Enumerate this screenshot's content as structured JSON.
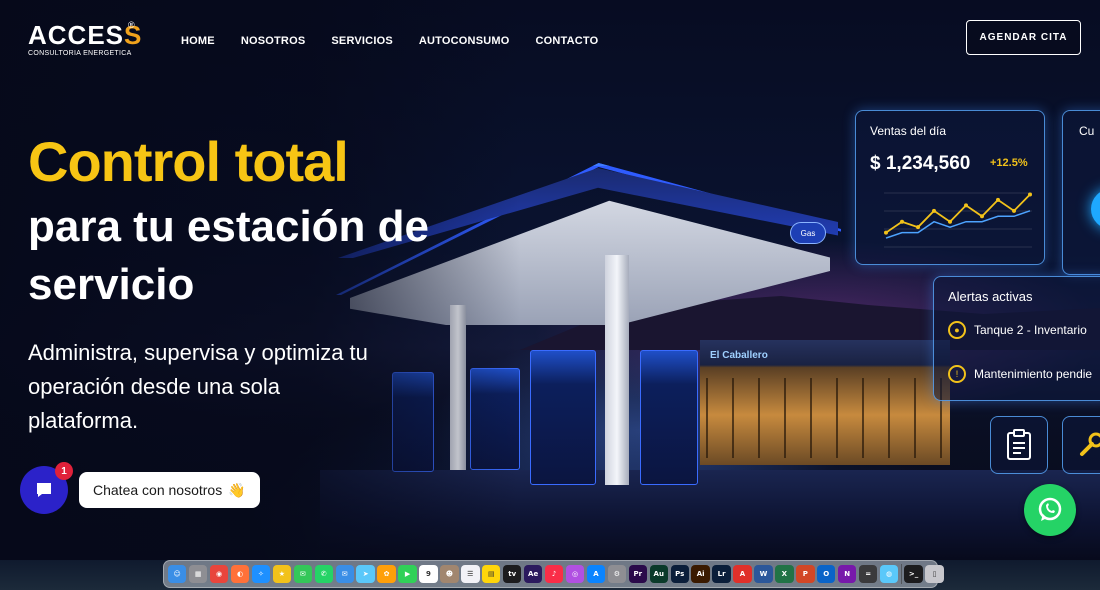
{
  "brand": {
    "logo_main": "ACCES",
    "logo_accent": "S",
    "registered": "®",
    "tagline": "CONSULTORIA ENERGETICA"
  },
  "nav": {
    "items": [
      {
        "label": "HOME"
      },
      {
        "label": "NOSOTROS"
      },
      {
        "label": "SERVICIOS"
      },
      {
        "label": "AUTOCONSUMO"
      },
      {
        "label": "CONTACTO"
      }
    ],
    "cta_label": "AGENDAR CITA"
  },
  "hero": {
    "headline_accent": "Control total",
    "headline_rest": "para tu estación de servicio",
    "description": "Administra, supervisa y optimiza tu operación desde una sola plataforma."
  },
  "dashboard": {
    "sales": {
      "title": "Ventas del día",
      "value": "$ 1,234,560",
      "change": "+12.5%",
      "chart_values_yellow": [
        3,
        5,
        4,
        7,
        5,
        8,
        6,
        9,
        7,
        10
      ],
      "chart_values_blue": [
        2,
        3,
        3,
        5,
        4,
        5,
        5,
        6,
        6,
        7
      ]
    },
    "second_card_title": "Cu",
    "alerts": {
      "title": "Alertas activas",
      "items": [
        {
          "text": "Tanque 2 - Inventario"
        },
        {
          "text": "Mantenimiento pendie"
        }
      ]
    }
  },
  "station": {
    "store_sign": "El Caballero",
    "brand_badge": "Gas"
  },
  "chat": {
    "badge_count": "1",
    "bubble_text": "Chatea con nosotros",
    "bubble_emoji": "👋"
  },
  "dock": {
    "icons": [
      {
        "name": "finder",
        "color": "#3a8ee6",
        "glyph": "☺"
      },
      {
        "name": "launchpad",
        "color": "#8e8e93",
        "glyph": "▦"
      },
      {
        "name": "chrome",
        "color": "#e8453c",
        "glyph": "◉"
      },
      {
        "name": "firefox",
        "color": "#ff7139",
        "glyph": "◐"
      },
      {
        "name": "safari",
        "color": "#1e90ff",
        "glyph": "✧"
      },
      {
        "name": "reeder",
        "color": "#f2c21a",
        "glyph": "★"
      },
      {
        "name": "messages",
        "color": "#34c759",
        "glyph": "✉"
      },
      {
        "name": "whatsapp",
        "color": "#25d366",
        "glyph": "✆"
      },
      {
        "name": "mail",
        "color": "#3a8ee6",
        "glyph": "✉"
      },
      {
        "name": "maps",
        "color": "#5ac8fa",
        "glyph": "➤"
      },
      {
        "name": "photos",
        "color": "#ff9f0a",
        "glyph": "✿"
      },
      {
        "name": "facetime",
        "color": "#30d158",
        "glyph": "▶"
      },
      {
        "name": "calendar",
        "color": "#ffffff",
        "glyph": "9"
      },
      {
        "name": "contacts",
        "color": "#a1866f",
        "glyph": "☻"
      },
      {
        "name": "reminders",
        "color": "#f2f2f7",
        "glyph": "☰"
      },
      {
        "name": "notes",
        "color": "#ffd60a",
        "glyph": "▤"
      },
      {
        "name": "tv",
        "color": "#1c1c1e",
        "glyph": "tv"
      },
      {
        "name": "after-effects",
        "color": "#2b1a5e",
        "glyph": "Ae"
      },
      {
        "name": "music",
        "color": "#fa2d48",
        "glyph": "♪"
      },
      {
        "name": "podcasts",
        "color": "#b150e2",
        "glyph": "◎"
      },
      {
        "name": "app-store",
        "color": "#0a84ff",
        "glyph": "A"
      },
      {
        "name": "system-settings",
        "color": "#8e8e93",
        "glyph": "⚙"
      },
      {
        "name": "premiere",
        "color": "#2a0a4a",
        "glyph": "Pr"
      },
      {
        "name": "audition",
        "color": "#0a3a2a",
        "glyph": "Au"
      },
      {
        "name": "photoshop",
        "color": "#0a1e3a",
        "glyph": "Ps"
      },
      {
        "name": "illustrator",
        "color": "#3a1a00",
        "glyph": "Ai"
      },
      {
        "name": "lightroom",
        "color": "#0a1e3a",
        "glyph": "Lr"
      },
      {
        "name": "acrobat",
        "color": "#e0302a",
        "glyph": "A"
      },
      {
        "name": "word",
        "color": "#2b579a",
        "glyph": "W"
      },
      {
        "name": "excel",
        "color": "#217346",
        "glyph": "X"
      },
      {
        "name": "powerpoint",
        "color": "#d24726",
        "glyph": "P"
      },
      {
        "name": "outlook",
        "color": "#0a64c8",
        "glyph": "O"
      },
      {
        "name": "onenote",
        "color": "#7719aa",
        "glyph": "N"
      },
      {
        "name": "calculator",
        "color": "#3a3a3c",
        "glyph": "="
      },
      {
        "name": "globe",
        "color": "#5ac8fa",
        "glyph": "◍"
      },
      {
        "name": "terminal",
        "color": "#1c1c1e",
        "glyph": ">_"
      },
      {
        "name": "trash",
        "color": "#c7c7cc",
        "glyph": "▯"
      }
    ]
  }
}
